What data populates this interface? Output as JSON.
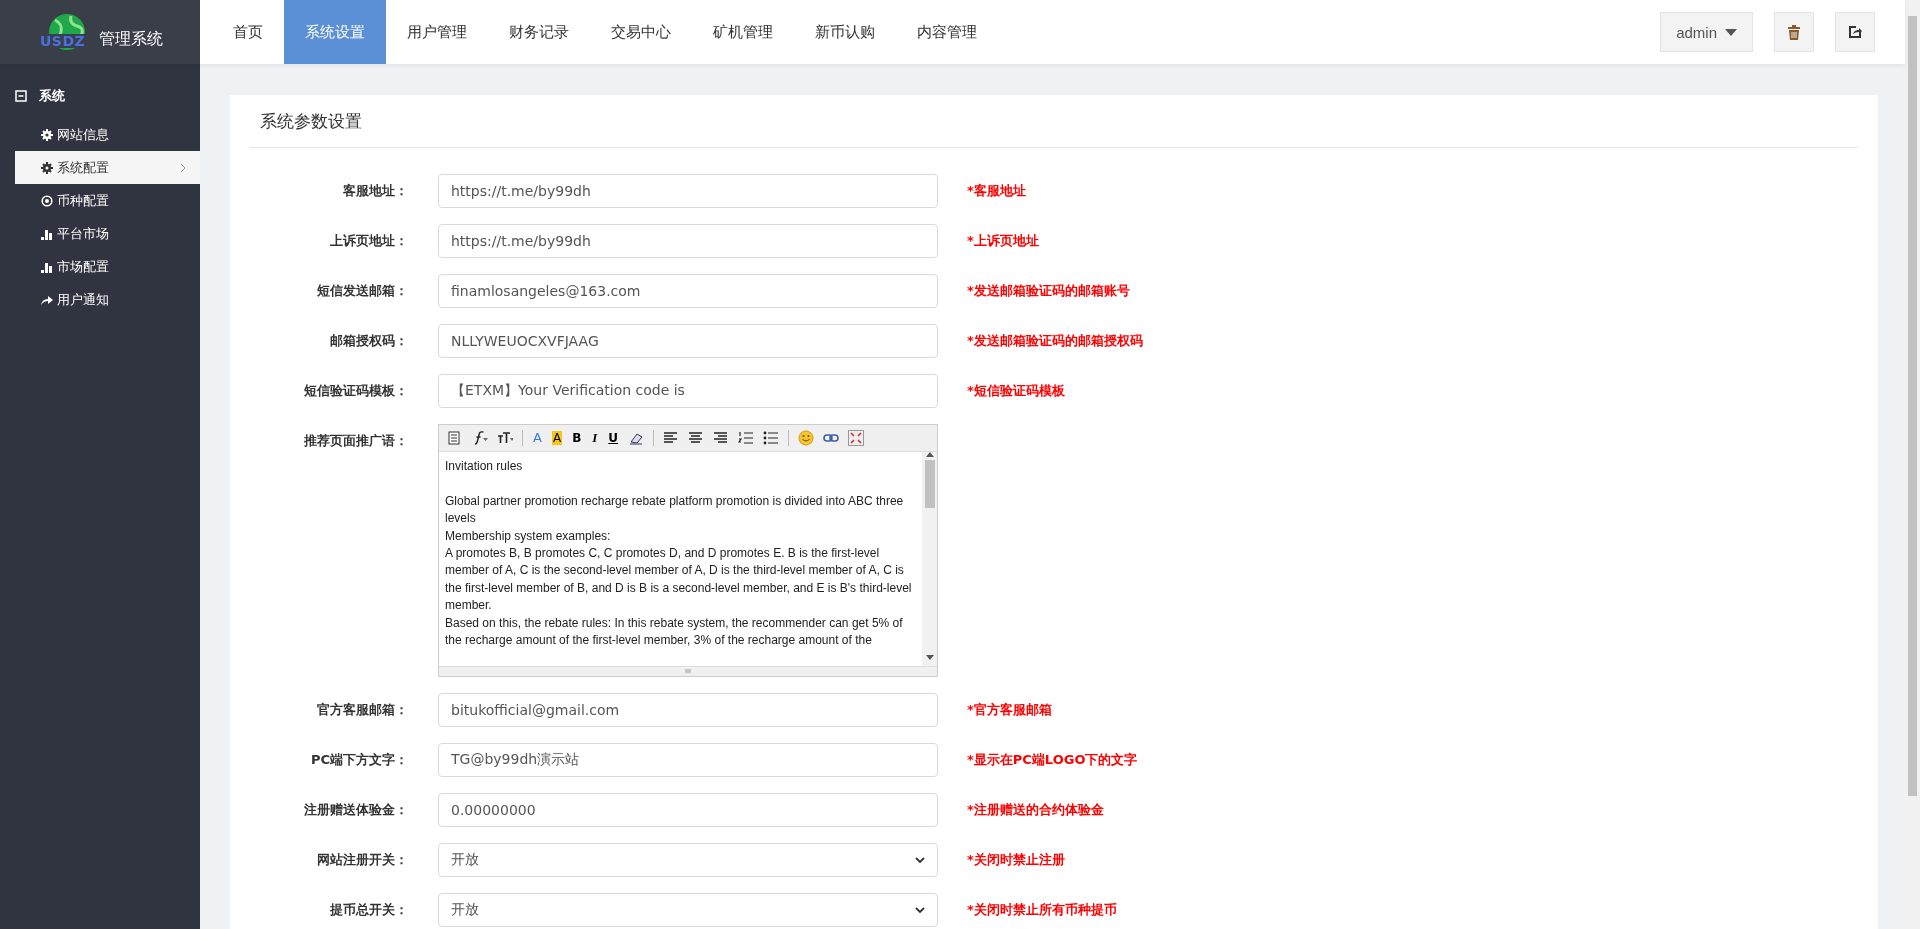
{
  "header": {
    "logo_text": "USDZ",
    "title": "管理系统",
    "user": "admin",
    "nav": [
      {
        "label": "首页",
        "selected": false
      },
      {
        "label": "系统设置",
        "selected": true
      },
      {
        "label": "用户管理",
        "selected": false
      },
      {
        "label": "财务记录",
        "selected": false
      },
      {
        "label": "交易中心",
        "selected": false
      },
      {
        "label": "矿机管理",
        "selected": false
      },
      {
        "label": "新币认购",
        "selected": false
      },
      {
        "label": "内容管理",
        "selected": false
      }
    ]
  },
  "sidebar": {
    "group": {
      "label": "系统",
      "expanded": true
    },
    "items": [
      {
        "label": "网站信息",
        "kind": "gear",
        "selected": false
      },
      {
        "label": "系统配置",
        "kind": "gear",
        "selected": true
      },
      {
        "label": "币种配置",
        "kind": "target",
        "selected": false
      },
      {
        "label": "平台市场",
        "kind": "bars",
        "selected": false
      },
      {
        "label": "市场配置",
        "kind": "bars",
        "selected": false
      },
      {
        "label": "用户通知",
        "kind": "share",
        "selected": false
      }
    ]
  },
  "form": {
    "title": "系统参数设置",
    "rows": [
      {
        "kind": "input",
        "label": "客服地址：",
        "value": "https://t.me/by99dh",
        "hint": "*客服地址"
      },
      {
        "kind": "input",
        "label": "上诉页地址：",
        "value": "https://t.me/by99dh",
        "hint": "*上诉页地址"
      },
      {
        "kind": "input",
        "label": "短信发送邮箱：",
        "value": "finamlosangeles@163.com",
        "hint": "*发送邮箱验证码的邮箱账号"
      },
      {
        "kind": "input",
        "label": "邮箱授权码：",
        "value": "NLLYWEUOCXVFJAAG",
        "hint": "*发送邮箱验证码的邮箱授权码"
      },
      {
        "kind": "input",
        "label": "短信验证码模板：",
        "value": "【ETXM】Your Verification code is",
        "hint": "*短信验证码模板"
      },
      {
        "kind": "editor",
        "label": "推荐页面推广语：",
        "toolbar": [
          {
            "kind": "paste"
          },
          {
            "kind": "font-family"
          },
          {
            "kind": "font-size"
          },
          {
            "kind": "sep"
          },
          {
            "kind": "font-color",
            "label": "A"
          },
          {
            "kind": "highlight",
            "label": "A"
          },
          {
            "kind": "bold",
            "label": "B"
          },
          {
            "kind": "italic",
            "label": "I"
          },
          {
            "kind": "underline",
            "label": "U"
          },
          {
            "kind": "eraser"
          },
          {
            "kind": "sep"
          },
          {
            "kind": "align-left"
          },
          {
            "kind": "align-center"
          },
          {
            "kind": "align-right"
          },
          {
            "kind": "ordered-list"
          },
          {
            "kind": "bullet-list"
          },
          {
            "kind": "sep"
          },
          {
            "kind": "emoji"
          },
          {
            "kind": "link"
          },
          {
            "kind": "fullscreen"
          }
        ],
        "paragraphs": [
          "Invitation rules",
          "Global partner promotion recharge rebate platform promotion is divided into ABC three levels",
          "Membership system examples:",
          "A promotes B, B promotes C, C promotes D, and D promotes E. B is the first-level member of A, C is the second-level member of A, D is the third-level member of A, C is the first-level member of B, and D is B is a second-level member, and E is B's third-level member.",
          "Based on this, the rebate rules: In this rebate system, the recommender can get 5% of the recharge amount of the first-level member, 3% of the recharge amount of the"
        ]
      },
      {
        "kind": "input",
        "label": "官方客服邮箱：",
        "value": "bitukofficial@gmail.com",
        "hint": "*官方客服邮箱"
      },
      {
        "kind": "input",
        "label": "PC端下方文字：",
        "value": "TG@by99dh演示站",
        "hint": "*显示在PC端LOGO下的文字"
      },
      {
        "kind": "input",
        "label": "注册赠送体验金：",
        "value": "0.00000000",
        "hint": "*注册赠送的合约体验金"
      },
      {
        "kind": "select",
        "label": "网站注册开关：",
        "value": "开放",
        "hint": "*关闭时禁止注册"
      },
      {
        "kind": "select",
        "label": "提币总开关：",
        "value": "开放",
        "hint": "*关闭时禁止所有币种提币"
      }
    ]
  }
}
